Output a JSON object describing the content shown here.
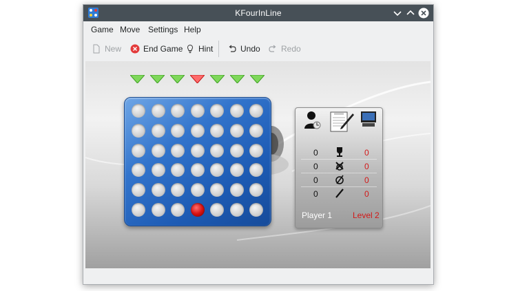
{
  "window": {
    "title": "KFourInLine",
    "icon": "kfourinline-app-icon"
  },
  "menu": [
    {
      "label": "Game"
    },
    {
      "label": "Move"
    },
    {
      "label": "Settings"
    },
    {
      "label": "Help"
    }
  ],
  "toolbar": {
    "new_label": "New",
    "end_game_label": "End Game",
    "hint_label": "Hint",
    "undo_label": "Undo",
    "redo_label": "Redo"
  },
  "board": {
    "columns": 7,
    "rows": 6,
    "pieces": [
      {
        "row": 5,
        "col": 3,
        "color": "red"
      }
    ],
    "column_markers": [
      "green",
      "green",
      "green",
      "red",
      "green",
      "green",
      "green"
    ]
  },
  "score": {
    "stats": [
      {
        "icon": "win-trophy-icon",
        "left": "0",
        "right": "0"
      },
      {
        "icon": "loss-icon",
        "left": "0",
        "right": "0"
      },
      {
        "icon": "draw-icon",
        "left": "0",
        "right": "0"
      },
      {
        "icon": "aborted-icon",
        "left": "0",
        "right": "0"
      }
    ],
    "player_label": "Player 1",
    "level_label": "Level 2"
  },
  "colors": {
    "titlebar": "#475057",
    "board_blue": "#1d5bb4",
    "red_piece": "#d91212",
    "green_marker": "#5dbb3a",
    "level_text": "#d21818"
  }
}
